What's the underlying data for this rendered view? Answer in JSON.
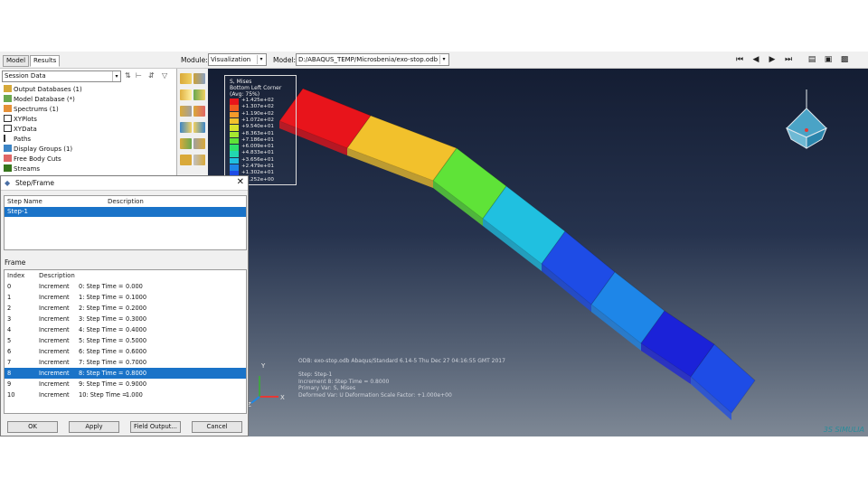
{
  "toolbar": {
    "tab_model": "Model",
    "tab_results": "Results",
    "module_label": "Module:",
    "module_value": "Visualization",
    "model_label": "Model:",
    "model_value": "D:/ABAQUS_TEMP/Microsbenia/exo-stop.odb",
    "icons": [
      "first-frame-icon",
      "previous-frame-icon",
      "next-frame-icon",
      "last-frame-icon",
      "animate-icon",
      "camera-icon",
      "record-icon"
    ]
  },
  "tree": {
    "session_value": "Session Data",
    "items": [
      {
        "label": "Output Databases (1)"
      },
      {
        "label": "Model Database (*)"
      },
      {
        "label": "Spectrums (1)"
      },
      {
        "label": "XYPlots"
      },
      {
        "label": "XYData"
      },
      {
        "label": "Paths"
      },
      {
        "label": "Display Groups (1)"
      },
      {
        "label": "Free Body Cuts"
      },
      {
        "label": "Streams"
      }
    ]
  },
  "legend": {
    "title_lines": [
      "S, Mises",
      "Bottom Left Corner",
      "(Avg: 75%)"
    ],
    "values": [
      "+1.425e+02",
      "+1.307e+02",
      "+1.190e+02",
      "+1.072e+02",
      "+9.540e+01",
      "+8.363e+01",
      "+7.186e+01",
      "+6.009e+01",
      "+4.833e+01",
      "+3.656e+01",
      "+2.479e+01",
      "+1.302e+01",
      "+1.252e+00"
    ],
    "colors": [
      "#e8141b",
      "#ee5a1f",
      "#f59a2a",
      "#f2c12c",
      "#d8e22c",
      "#a6e830",
      "#5fe338",
      "#2de16a",
      "#22d7b0",
      "#20c0e0",
      "#1e86e8",
      "#1e4ce6",
      "#1b22d8"
    ]
  },
  "viewport": {
    "info_lines": [
      "ODB: exo-stop.odb     Abaqus/Standard 6.14-5     Thu Dec 27 04:16:55 GMT 2017",
      "",
      "Step: Step-1",
      "Increment     8: Step Time =    0.8000",
      "Primary Var: S, Mises",
      "Deformed Var: U    Deformation Scale Factor: +1.000e+00"
    ],
    "axis_x": "X",
    "axis_y": "Y",
    "axis_z": "Z",
    "brand": "3S SIMULIA"
  },
  "dialog": {
    "title": "Step/Frame",
    "step_headers": [
      "Step Name",
      "Description"
    ],
    "steps": [
      {
        "name": "Step-1",
        "description": ""
      }
    ],
    "frame_label": "Frame",
    "frame_headers": [
      "Index",
      "Description"
    ],
    "frames": [
      {
        "index": "0",
        "type": "Increment",
        "desc": "0: Step Time =",
        "time": "0.000"
      },
      {
        "index": "1",
        "type": "Increment",
        "desc": "1: Step Time =",
        "time": "0.1000"
      },
      {
        "index": "2",
        "type": "Increment",
        "desc": "2: Step Time =",
        "time": "0.2000"
      },
      {
        "index": "3",
        "type": "Increment",
        "desc": "3: Step Time =",
        "time": "0.3000"
      },
      {
        "index": "4",
        "type": "Increment",
        "desc": "4: Step Time =",
        "time": "0.4000"
      },
      {
        "index": "5",
        "type": "Increment",
        "desc": "5: Step Time =",
        "time": "0.5000"
      },
      {
        "index": "6",
        "type": "Increment",
        "desc": "6: Step Time =",
        "time": "0.6000"
      },
      {
        "index": "7",
        "type": "Increment",
        "desc": "7: Step Time =",
        "time": "0.7000"
      },
      {
        "index": "8",
        "type": "Increment",
        "desc": "8: Step Time =",
        "time": "0.8000"
      },
      {
        "index": "9",
        "type": "Increment",
        "desc": "9: Step Time =",
        "time": "0.9000"
      },
      {
        "index": "10",
        "type": "Increment",
        "desc": "10: Step Time =",
        "time": "1.000"
      }
    ],
    "selected_frame": 8,
    "buttons": {
      "ok": "OK",
      "apply": "Apply",
      "field_output": "Field Output...",
      "cancel": "Cancel"
    }
  }
}
